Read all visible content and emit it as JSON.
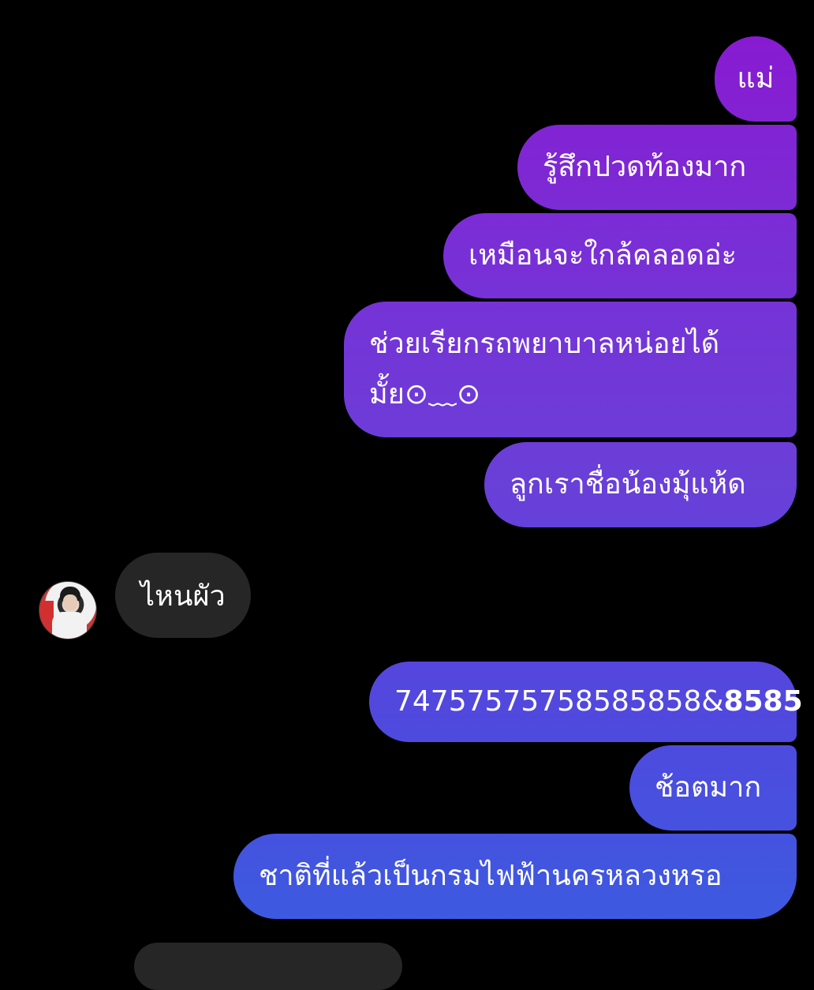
{
  "conversation": {
    "sent_group_1": [
      "แม่",
      "รู้สึกปวดท้องมาก",
      "เหมือนจะใกล้คลอดอ่ะ",
      "ช่วยเรียกรถพยาบาลหน่อยได้มั้ย⊙﹏⊙",
      "ลูกเราชื่อน้องมุ้แห้ด"
    ],
    "received": [
      "ไหนผัว"
    ],
    "sent_group_2": {
      "msg1_regular": "74757575758585858&",
      "msg1_bold": "8585",
      "msg2": "ช้อตมาก",
      "msg3": "ชาติที่แล้วเป็นกรมไฟฟ้านครหลวงหรอ"
    }
  },
  "colors": {
    "background": "#000000",
    "received_bubble": "#262626",
    "sent_gradient_top": "#8a17d0",
    "sent_gradient_bottom": "#3a5ce0",
    "text": "#ffffff"
  },
  "icons": {
    "avatar": "contact-avatar-photo"
  }
}
